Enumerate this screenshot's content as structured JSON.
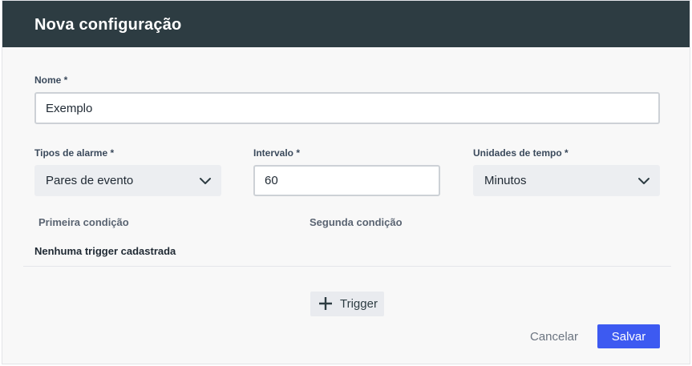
{
  "dialog": {
    "title": "Nova configuração"
  },
  "form": {
    "name": {
      "label": "Nome *",
      "value": "Exemplo"
    },
    "alarm_type": {
      "label": "Tipos de alarme *",
      "value": "Pares de evento"
    },
    "interval": {
      "label": "Intervalo *",
      "value": "60"
    },
    "time_unit": {
      "label": "Unidades de tempo *",
      "value": "Minutos"
    }
  },
  "triggers": {
    "columns": [
      "Primeira condição",
      "Segunda condição"
    ],
    "empty_text": "Nenhuma trigger cadastrada",
    "add_label": "Trigger"
  },
  "footer": {
    "cancel_label": "Cancelar",
    "save_label": "Salvar"
  },
  "icons": {
    "add": "plus-icon",
    "dropdown": "chevron-down-icon"
  },
  "colors": {
    "header": "#2d3c42",
    "primary": "#3d5af1"
  }
}
